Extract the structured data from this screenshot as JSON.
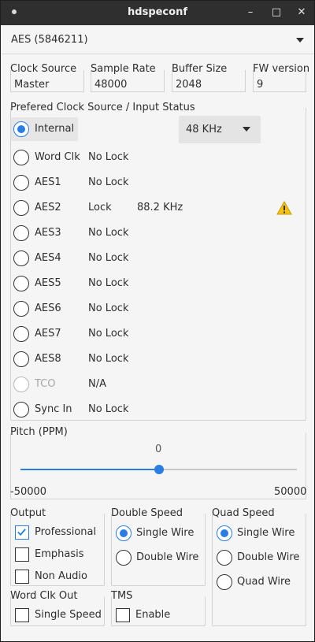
{
  "window": {
    "title": "hdspeconf",
    "controls": [
      "–",
      "□",
      "✕"
    ]
  },
  "device": {
    "selected": "AES (5846211)"
  },
  "info": {
    "clock_source": {
      "label": "Clock Source",
      "value": "Master"
    },
    "sample_rate": {
      "label": "Sample Rate",
      "value": "48000"
    },
    "buffer_size": {
      "label": "Buffer Size",
      "value": "2048"
    },
    "fw_version": {
      "label": "FW version",
      "value": "9"
    }
  },
  "clock_group": {
    "title": "Prefered Clock Source / Input Status",
    "internal": {
      "label": "Internal",
      "selected": true,
      "freq": "48 KHz"
    },
    "sources": [
      {
        "label": "Word Clk",
        "status": "No Lock",
        "freq": ""
      },
      {
        "label": "AES1",
        "status": "No Lock",
        "freq": ""
      },
      {
        "label": "AES2",
        "status": "Lock",
        "freq": "88.2 KHz",
        "warning": true
      },
      {
        "label": "AES3",
        "status": "No Lock",
        "freq": ""
      },
      {
        "label": "AES4",
        "status": "No Lock",
        "freq": ""
      },
      {
        "label": "AES5",
        "status": "No Lock",
        "freq": ""
      },
      {
        "label": "AES6",
        "status": "No Lock",
        "freq": ""
      },
      {
        "label": "AES7",
        "status": "No Lock",
        "freq": ""
      },
      {
        "label": "AES8",
        "status": "No Lock",
        "freq": ""
      },
      {
        "label": "TCO",
        "status": "N/A",
        "freq": "",
        "disabled": true
      },
      {
        "label": "Sync In",
        "status": "No Lock",
        "freq": ""
      }
    ]
  },
  "pitch": {
    "title": "Pitch (PPM)",
    "value": "0",
    "min": "-50000",
    "max": "50000",
    "fraction": 0.5
  },
  "output": {
    "title": "Output",
    "items": [
      {
        "label": "Professional",
        "checked": true
      },
      {
        "label": "Emphasis",
        "checked": false
      },
      {
        "label": "Non Audio",
        "checked": false
      }
    ]
  },
  "double_speed": {
    "title": "Double Speed",
    "items": [
      {
        "label": "Single Wire",
        "selected": true
      },
      {
        "label": "Double Wire",
        "selected": false
      }
    ]
  },
  "quad_speed": {
    "title": "Quad Speed",
    "items": [
      {
        "label": "Single Wire",
        "selected": true
      },
      {
        "label": "Double Wire",
        "selected": false
      },
      {
        "label": "Quad Wire",
        "selected": false
      }
    ]
  },
  "word_clk_out": {
    "title": "Word Clk Out",
    "item": {
      "label": "Single Speed",
      "checked": false
    }
  },
  "tms": {
    "title": "TMS",
    "item": {
      "label": "Enable",
      "checked": false
    }
  },
  "colors": {
    "accent": "#2a7de1",
    "titlebar": "#2f2f2f",
    "warning": "#f5c211"
  }
}
